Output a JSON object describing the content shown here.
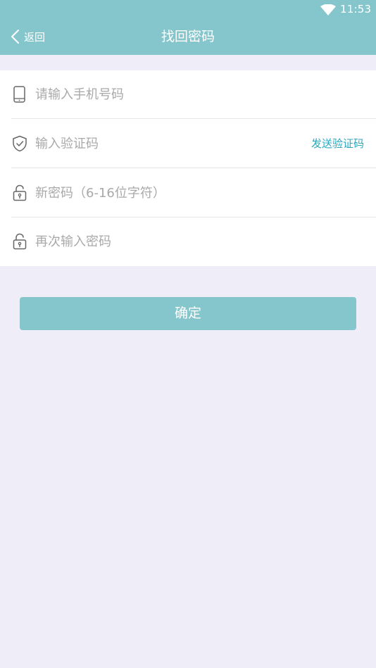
{
  "status_bar": {
    "time": "11:53",
    "wifi_icon": "wifi-icon"
  },
  "header": {
    "back_label": "返回",
    "back_icon": "chevron-left-icon",
    "title": "找回密码"
  },
  "form": {
    "phone": {
      "icon": "phone-icon",
      "placeholder": "请输入手机号码",
      "value": ""
    },
    "verification_code": {
      "icon": "shield-check-icon",
      "placeholder": "输入验证码",
      "value": "",
      "send_code_label": "发送验证码"
    },
    "new_password": {
      "icon": "lock-icon",
      "placeholder": "新密码（6-16位字符）",
      "value": ""
    },
    "confirm_password": {
      "icon": "lock-icon",
      "placeholder": "再次输入密码",
      "value": ""
    }
  },
  "actions": {
    "confirm_label": "确定"
  },
  "colors": {
    "primary": "#84c6cc",
    "link": "#2aa8bf",
    "background": "#efedf8",
    "placeholder": "#a9a9a9"
  }
}
